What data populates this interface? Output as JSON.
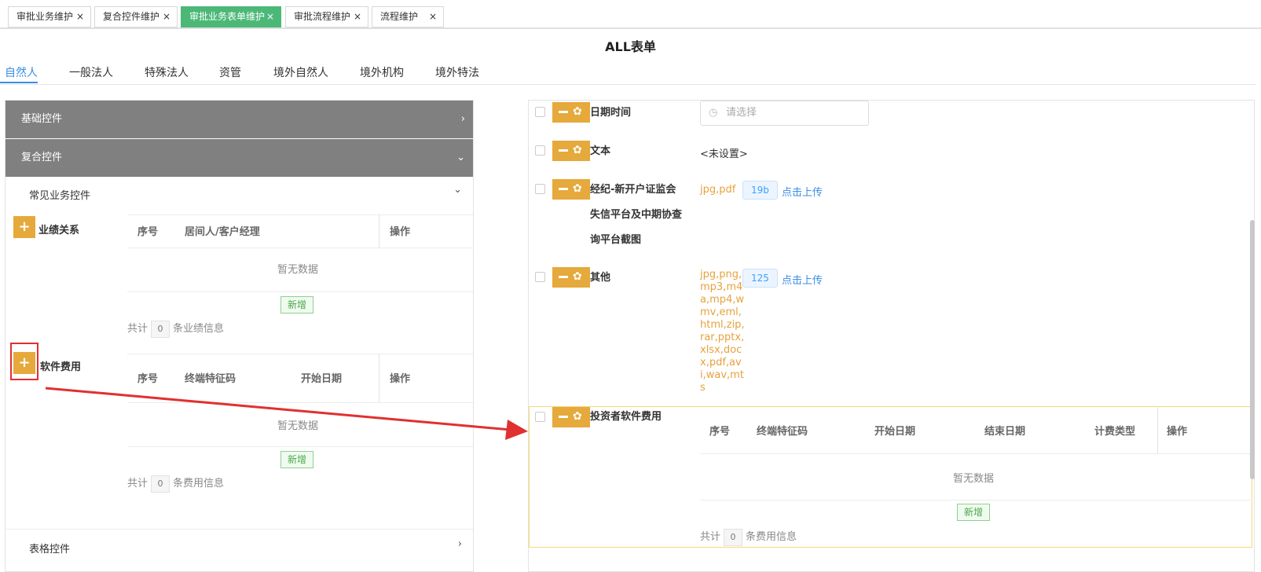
{
  "top_tabs": [
    {
      "label": "审批业务维护",
      "close": "×"
    },
    {
      "label": "复合控件维护",
      "close": "×"
    },
    {
      "label": "审批业务表单维护",
      "close": "×"
    },
    {
      "label": "审批流程维护",
      "close": "×"
    },
    {
      "label": "流程维护",
      "close": "×"
    }
  ],
  "page_title": "ALL表单",
  "section_tabs": [
    "自然人",
    "一般法人",
    "特殊法人",
    "资管",
    "境外自然人",
    "境外机构",
    "境外特法"
  ],
  "left": {
    "basic_controls": "基础控件",
    "composite_controls": "复合控件",
    "common_business": "常见业务控件",
    "table_controls": "表格控件",
    "chev_right": "›",
    "chev_down": "⌄",
    "plus": "+",
    "perf": {
      "label": "业绩关系",
      "headers": [
        "序号",
        "居间人/客户经理",
        "操作"
      ],
      "empty": "暂无数据",
      "add": "新增",
      "total_prefix": "共计",
      "count": "0",
      "total_suffix": "条业绩信息"
    },
    "soft": {
      "label": "软件费用",
      "headers": [
        "序号",
        "终端特征码",
        "开始日期",
        "操作"
      ],
      "empty": "暂无数据",
      "add": "新增",
      "total_prefix": "共计",
      "count": "0",
      "total_suffix": "条费用信息"
    }
  },
  "right": {
    "gear": "✿",
    "rows": [
      {
        "label": "日期时间",
        "placeholder": "请选择",
        "clock": "◷"
      },
      {
        "label": "文本",
        "value": "<未设置>"
      },
      {
        "label_lines": [
          "经纪-新开户证监会",
          "失信平台及中期协查",
          "询平台截图"
        ],
        "types": "jpg,pdf",
        "size": "19b",
        "upload": "点击上传"
      },
      {
        "label": "其他",
        "types_lines": [
          "jpg,png,",
          "mp3,m4",
          "a,mp4,w",
          "mv,eml,",
          "html,zip,",
          "rar,pptx,",
          "xlsx,doc",
          "x,pdf,av",
          "i,wav,mt",
          "s"
        ],
        "size": "125",
        "upload": "点击上传"
      }
    ],
    "investor": {
      "label": "投资者软件费用",
      "headers": [
        "序号",
        "终端特征码",
        "开始日期",
        "结束日期",
        "计费类型",
        "操作"
      ],
      "empty": "暂无数据",
      "add": "新增",
      "total_prefix": "共计",
      "count": "0",
      "total_suffix": "条费用信息"
    }
  },
  "colors": {
    "accent_green": "#4cb878",
    "control_orange": "#e6a93c",
    "annotation_red": "#e03030",
    "link_blue": "#3a8ee6"
  }
}
